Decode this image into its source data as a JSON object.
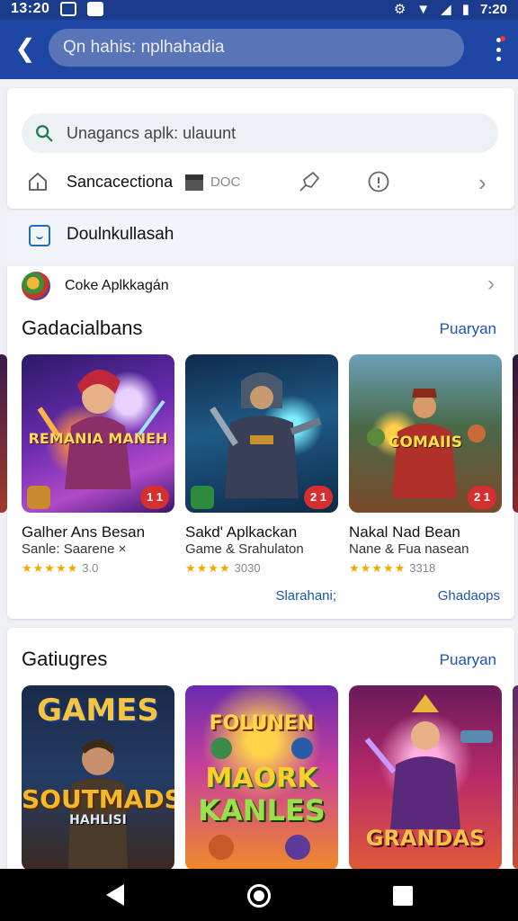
{
  "status_bar": {
    "time_left": "13:20",
    "time_right": "7:20",
    "bluetooth": "⚙",
    "wifi": "▼",
    "signal": "◢",
    "battery": "▮"
  },
  "app_bar": {
    "back_glyph": "❮",
    "search_text": "Qn hahis: nplhahadia"
  },
  "top_card": {
    "search_placeholder": "Unagancs aplk: ulauunt",
    "tool_label": "Sancacectiona",
    "doc_label": "DOC",
    "chevron": "›"
  },
  "downloads": {
    "label": "Doulnkullasah"
  },
  "featured": {
    "label": "Coke Aplkkagán",
    "chevron": "›"
  },
  "section1": {
    "title": "Gadacialbans",
    "link": "Puaryan",
    "tiles": [
      {
        "art_title": "REMANIA MANEH",
        "badge": "1 1",
        "name": "Galher Ans Besan",
        "sub": "Sanle: Saarene ×",
        "stars": "★★★★★",
        "rating": "3.0",
        "more": ""
      },
      {
        "art_title": "",
        "badge": "2 1",
        "name": "Sakd' Aplkackan",
        "sub": "Game & Srahulaton",
        "stars": "★★★★",
        "rating": "3030",
        "more": "Slarahani;"
      },
      {
        "art_title": "COMAIIS",
        "badge": "2 1",
        "name": "Nakal Nad Bean",
        "sub": "Nane & Fua nasean",
        "stars": "★★★★★",
        "rating": "3318",
        "more": "Ghadaops"
      }
    ]
  },
  "section2": {
    "title": "Gatiugres",
    "link": "Puaryan",
    "tiles": [
      {
        "art_title_top": "GAMES",
        "art_title_mid": "SOUTMADS",
        "art_title_low": "HAHLISI"
      },
      {
        "art_title_top": "FOLUNEN",
        "art_title_mid": "MAORK",
        "art_title_low": "KANLES"
      },
      {
        "art_title_top": "",
        "art_title_mid": "",
        "art_title_low": "GRANDAS"
      }
    ]
  },
  "nav_bar": {}
}
